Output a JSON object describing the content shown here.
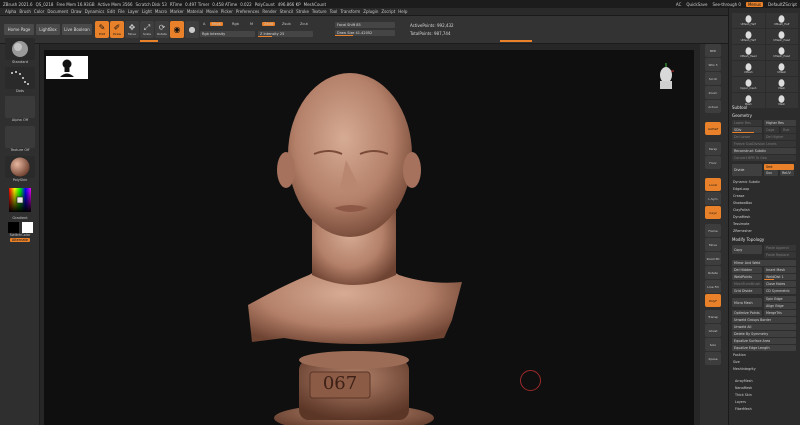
{
  "titlebar": {
    "app": "ZBrush 2021.6",
    "file": "QS_0218",
    "stats": [
      "Free Mem 16.93GB",
      "Active Mem 3566",
      "Scratch Disk 53",
      "RTime",
      "0.497 Timer",
      "0.458 ATime",
      "0.022",
      "PolyCount",
      "496.866 KP",
      "MeshCount"
    ],
    "ac": "AC",
    "quicksave": "QuickSave",
    "see_through": "See-through 0",
    "menus": "Menus",
    "script": "DefaultZScript"
  },
  "menubar": [
    "Alpha",
    "Brush",
    "Color",
    "Document",
    "Draw",
    "Dynamics",
    "Edit",
    "File",
    "Layer",
    "Light",
    "Macro",
    "Marker",
    "Material",
    "Movie",
    "Picker",
    "Preferences",
    "Render",
    "Stencil",
    "Stroke",
    "Texture",
    "Tool",
    "Transform",
    "Zplugin",
    "Zscript",
    "Help"
  ],
  "toptools": {
    "home_page": "Home Page",
    "lightbox": "LightBox",
    "live_boolean": "Live Boolean",
    "edit": "Edit",
    "draw": "Draw",
    "move": "Move",
    "scale": "Scale",
    "rotate": "Rotate",
    "a_label": "A",
    "mrgb": "Mrgb",
    "rgb": "Rgb",
    "m": "M",
    "zadd": "Zadd",
    "zsub": "Zsub",
    "zcut": "Zcut",
    "rgb_intensity": "Rgb Intensity",
    "z_intensity": "Z Intensity 25",
    "focal_shift": "Focal Shift 85",
    "draw_size": "Draw Size 41.42052",
    "active_points": "ActivePoints: 992,432",
    "total_points": "TotalPoints: 987,744"
  },
  "leftshelf": {
    "brush": "Standard",
    "stroke": "Dots",
    "alpha": "Alpha Off",
    "texture": "Texture Off",
    "material": "PolySkin",
    "gradient": "Gradient",
    "switch_color": "SwitchColor",
    "alternate": "Alternate"
  },
  "canvas": {
    "plate_number": "067"
  },
  "rightshelf": [
    "BPR",
    "SPix 3",
    "Scroll",
    "Zoom",
    "Actual",
    "AAHalf",
    "Persp",
    "Floor",
    "Local",
    "L.Sym",
    "Gxyz",
    "Frame",
    "Move",
    "Zoom3D",
    "Rotate",
    "Line Fill",
    "PolyF",
    "Transp",
    "Ghost",
    "Solo",
    "Xpose"
  ],
  "colors": {
    "accent": "#e8812a",
    "skin": "#c99a80",
    "canvas": "#0f0f0f"
  },
  "tray": {
    "thumbs": [
      "UMesh_Half",
      "UMesh_Half",
      "UMesh_Half",
      "UMesh_Head",
      "UMesh_Head",
      "UMesh_Head",
      "UMesh",
      "UMesh",
      "Upper_mesh",
      "Mesh",
      "Mesh",
      "Mesh"
    ],
    "subtool": "Subtool",
    "geometry": "Geometry",
    "lower_res": "Lower Res",
    "higher_res": "Higher Res",
    "sdiv": "SDiv",
    "cage": "Cage",
    "rstr": "Rstr",
    "del_lower": "Del Lower",
    "del_higher": "Del Higher",
    "freeze_subdivision": "Freeze SubDivision Levels",
    "reconstruct_subdiv": "Reconstruct Subdiv",
    "convert_bpr": "Convert BPR To Geo",
    "divide": "Divide",
    "smt": "Smt",
    "suv": "Suv",
    "relax": "ReUV",
    "dynamic_subdiv": "Dynamic Subdiv",
    "edgeloop": "EdgeLoop",
    "crease": "Crease",
    "shadowbox": "ShadowBox",
    "clayPolish": "ClayPolish",
    "dynamesh": "DynaMesh",
    "tessimate": "Tessimate",
    "zremesher": "ZRemesher",
    "modify_topology": "Modify Topology",
    "copy": "Copy",
    "paste_append": "Paste Append",
    "paste_replace": "Paste Replace",
    "mirror_weld": "Mirror And Weld",
    "del_hidden": "Del Hidden",
    "insert_mesh": "Insert Mesh",
    "weldpoints": "WeldPoints",
    "weld_dist": "WeldDist 1",
    "meshfrombrush": "MeshFromBrush",
    "close_holes": "Close Holes",
    "grid_divide": "Grid Divide",
    "cd_symmetric": "CD Symmetric",
    "micro_mesh": "Micro Mesh",
    "spin_edge": "Spin Edge",
    "align_edge": "Align Edge",
    "optimize_points": "Optimize Points",
    "merge_tris": "MergeTris",
    "unweld_groups": "Unweld Groups Border",
    "unweld_all": "Unweld All",
    "delete_by_symmetry": "Delete By Symmetry",
    "equalize_surface": "Equalize Surface Area",
    "equalize_edge": "Equalize Edge Length",
    "position": "Position",
    "size": "Size",
    "mesh_integrity": "MeshIntegrity",
    "arraymesh": "ArrayMesh",
    "nanomesh": "NanoMesh",
    "thick_skin": "Thick Skin",
    "layers": "Layers",
    "fibermesh": "FiberMesh"
  }
}
